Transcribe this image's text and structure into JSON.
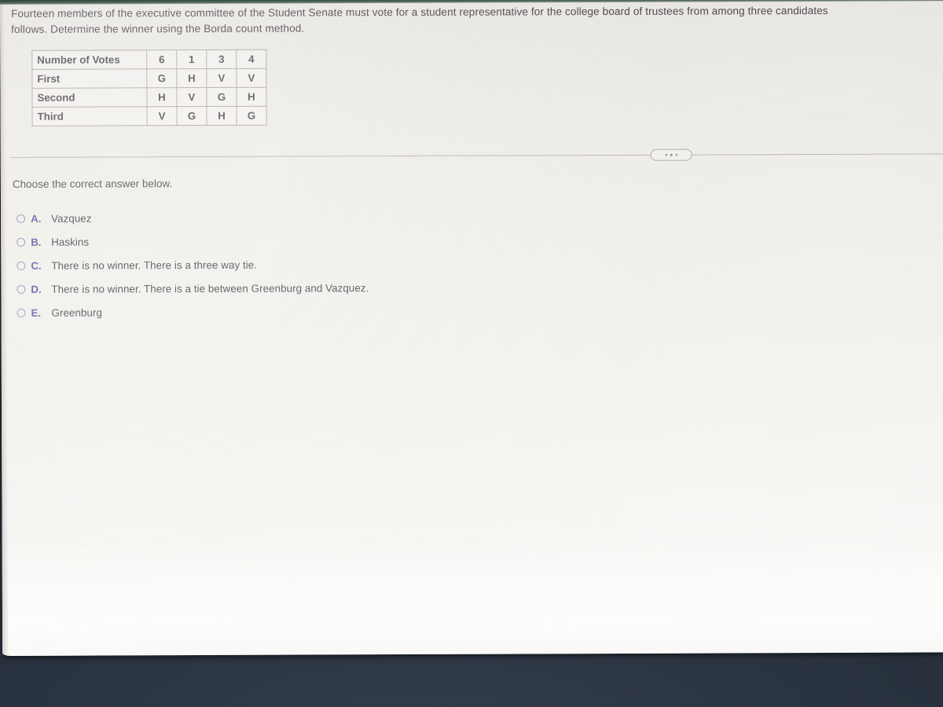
{
  "question": {
    "prompt": "Fourteen members of the executive committee of the Student Senate must vote for a student representative for the college board of trustees from among three candidates\nfollows. Determine the winner using the Borda count method."
  },
  "preference_table": {
    "row_labels": [
      "Number of Votes",
      "First",
      "Second",
      "Third"
    ],
    "rows": [
      {
        "label": "Number of Votes",
        "cells": [
          "6",
          "1",
          "3",
          "4"
        ]
      },
      {
        "label": "First",
        "cells": [
          "G",
          "H",
          "V",
          "V"
        ]
      },
      {
        "label": "Second",
        "cells": [
          "H",
          "V",
          "G",
          "H"
        ]
      },
      {
        "label": "Third",
        "cells": [
          "V",
          "G",
          "H",
          "G"
        ]
      }
    ]
  },
  "divider": {
    "ellipsis_icon": "ellipsis-icon",
    "dots": "..."
  },
  "choose_label": "Choose the correct answer below.",
  "answers": [
    {
      "letter": "A.",
      "text": "Vazquez",
      "selected": false
    },
    {
      "letter": "B.",
      "text": "Haskins",
      "selected": false
    },
    {
      "letter": "C.",
      "text": "There is no winner. There is a three way tie.",
      "selected": false
    },
    {
      "letter": "D.",
      "text": "There is no winner. There is a tie between Greenburg and Vazquez.",
      "selected": false
    },
    {
      "letter": "E.",
      "text": "Greenburg",
      "selected": false
    }
  ],
  "colors": {
    "page_background": "#efeee9",
    "desk_background": "#2a3340",
    "text": "#423d48",
    "option_letter": "#5a4c9a",
    "radio_border": "#8e8cc0",
    "table_border": "#a9a39f",
    "divider_line": "#b4b0ac"
  }
}
